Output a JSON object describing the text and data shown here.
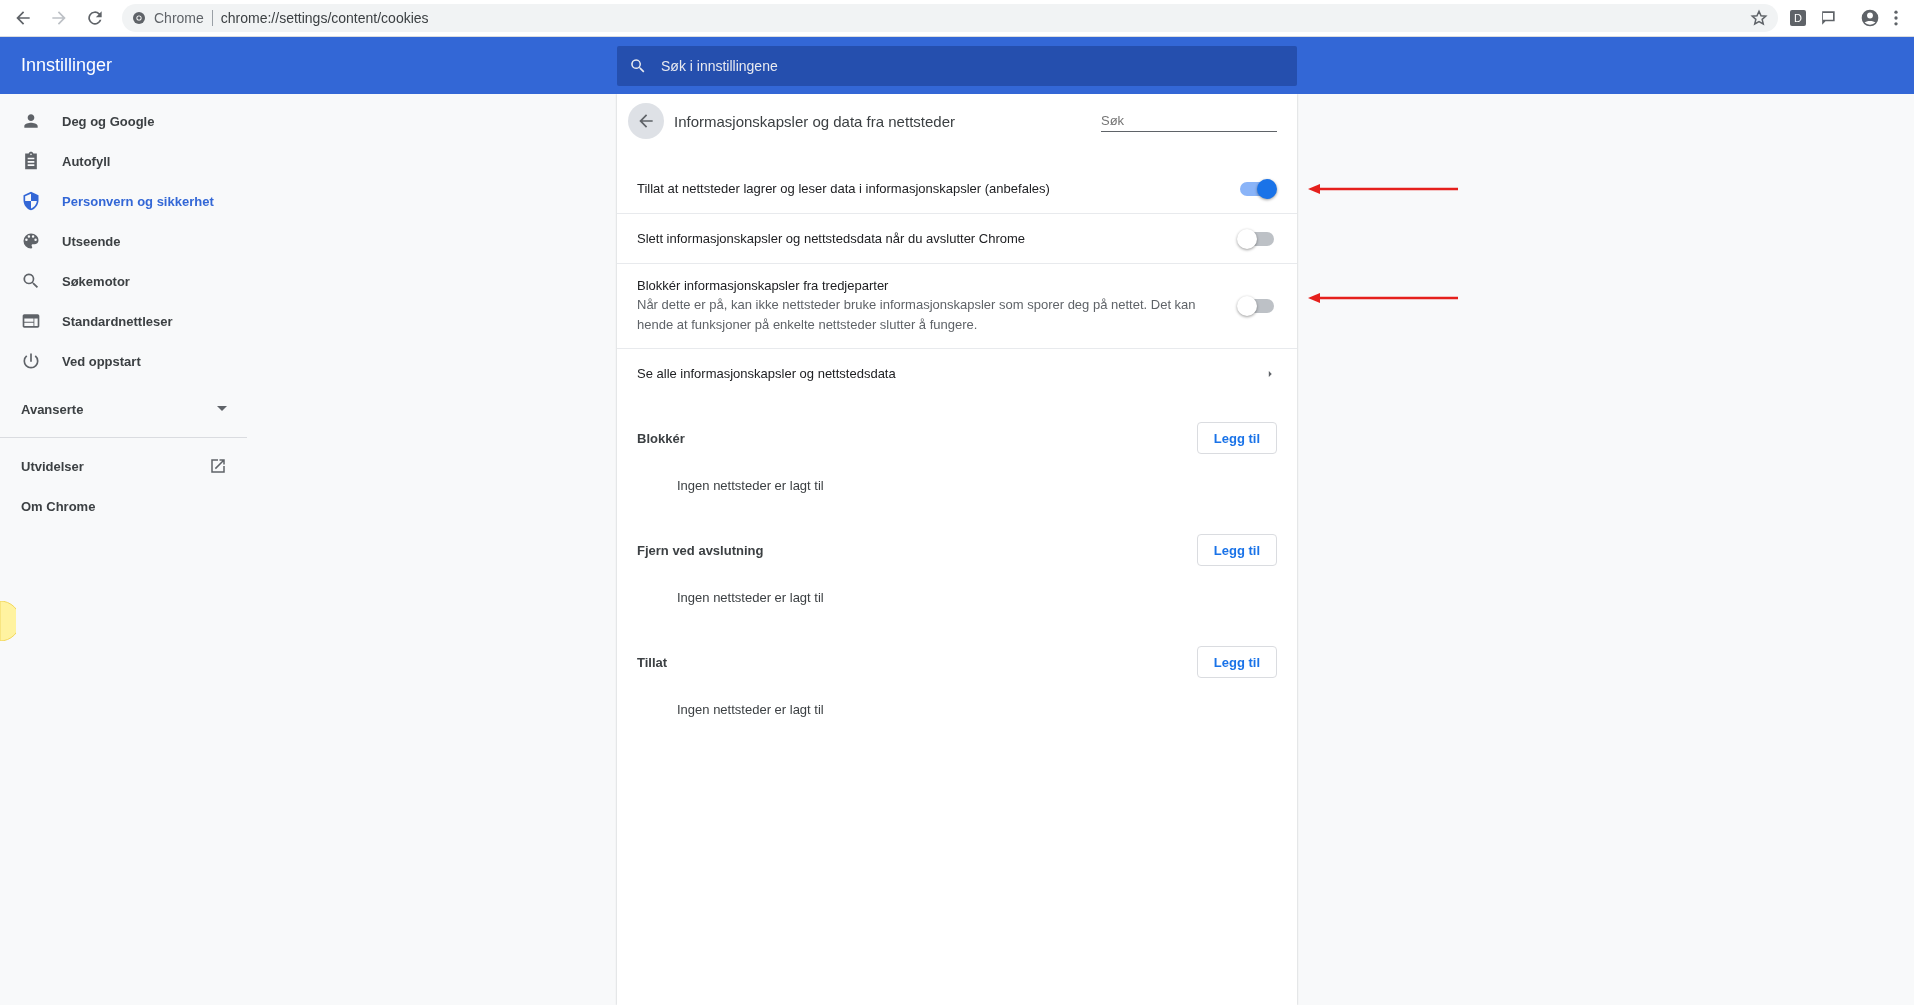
{
  "browser": {
    "site_label": "Chrome",
    "url": "chrome://settings/content/cookies",
    "profile_letter": "D"
  },
  "header": {
    "title": "Innstillinger",
    "search_placeholder": "Søk i innstillingene"
  },
  "sidebar": {
    "items": [
      {
        "label": "Deg og Google",
        "selected": false
      },
      {
        "label": "Autofyll",
        "selected": false
      },
      {
        "label": "Personvern og sikkerhet",
        "selected": true
      },
      {
        "label": "Utseende",
        "selected": false
      },
      {
        "label": "Søkemotor",
        "selected": false
      },
      {
        "label": "Standardnettleser",
        "selected": false
      },
      {
        "label": "Ved oppstart",
        "selected": false
      }
    ],
    "advanced": {
      "label": "Avanserte",
      "expanded": false
    },
    "links": [
      {
        "label": "Utvidelser",
        "external": true
      },
      {
        "label": "Om Chrome",
        "external": false
      }
    ]
  },
  "page": {
    "title": "Informasjonskapsler og data fra nettsteder",
    "search_placeholder": "Søk",
    "settings": [
      {
        "kind": "toggle",
        "label": "Tillat at nettsteder lagrer og leser data i informasjonskapsler (anbefales)",
        "on": true,
        "annotated": true
      },
      {
        "kind": "toggle",
        "label": "Slett informasjonskapsler og nettstedsdata når du avslutter Chrome",
        "on": false,
        "annotated": false
      },
      {
        "kind": "toggle",
        "label": "Blokkér informasjonskapsler fra tredjeparter",
        "description": "Når dette er på, kan ikke nettsteder bruke informasjonskapsler som sporer deg på nettet. Det kan hende at funksjoner på enkelte nettsteder slutter å fungere.",
        "on": false,
        "annotated": true
      },
      {
        "kind": "link",
        "label": "Se alle informasjonskapsler og nettstedsdata"
      }
    ],
    "sections": [
      {
        "title": "Blokkér",
        "button": "Legg til",
        "empty": "Ingen nettsteder er lagt til"
      },
      {
        "title": "Fjern ved avslutning",
        "button": "Legg til",
        "empty": "Ingen nettsteder er lagt til"
      },
      {
        "title": "Tillat",
        "button": "Legg til",
        "empty": "Ingen nettsteder er lagt til"
      }
    ]
  }
}
